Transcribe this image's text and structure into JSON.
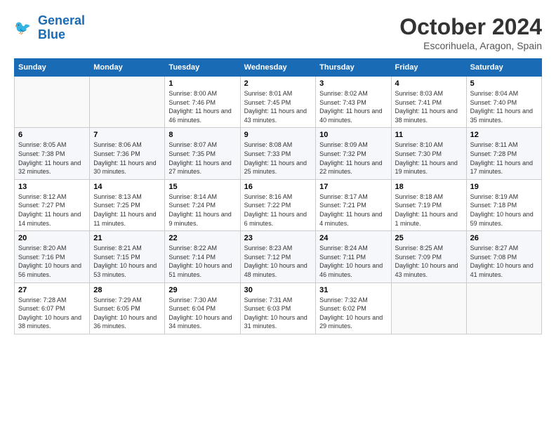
{
  "header": {
    "logo_line1": "General",
    "logo_line2": "Blue",
    "month": "October 2024",
    "location": "Escorihuela, Aragon, Spain"
  },
  "days_of_week": [
    "Sunday",
    "Monday",
    "Tuesday",
    "Wednesday",
    "Thursday",
    "Friday",
    "Saturday"
  ],
  "weeks": [
    [
      {
        "day": "",
        "sunrise": "",
        "sunset": "",
        "daylight": ""
      },
      {
        "day": "",
        "sunrise": "",
        "sunset": "",
        "daylight": ""
      },
      {
        "day": "1",
        "sunrise": "Sunrise: 8:00 AM",
        "sunset": "Sunset: 7:46 PM",
        "daylight": "Daylight: 11 hours and 46 minutes."
      },
      {
        "day": "2",
        "sunrise": "Sunrise: 8:01 AM",
        "sunset": "Sunset: 7:45 PM",
        "daylight": "Daylight: 11 hours and 43 minutes."
      },
      {
        "day": "3",
        "sunrise": "Sunrise: 8:02 AM",
        "sunset": "Sunset: 7:43 PM",
        "daylight": "Daylight: 11 hours and 40 minutes."
      },
      {
        "day": "4",
        "sunrise": "Sunrise: 8:03 AM",
        "sunset": "Sunset: 7:41 PM",
        "daylight": "Daylight: 11 hours and 38 minutes."
      },
      {
        "day": "5",
        "sunrise": "Sunrise: 8:04 AM",
        "sunset": "Sunset: 7:40 PM",
        "daylight": "Daylight: 11 hours and 35 minutes."
      }
    ],
    [
      {
        "day": "6",
        "sunrise": "Sunrise: 8:05 AM",
        "sunset": "Sunset: 7:38 PM",
        "daylight": "Daylight: 11 hours and 32 minutes."
      },
      {
        "day": "7",
        "sunrise": "Sunrise: 8:06 AM",
        "sunset": "Sunset: 7:36 PM",
        "daylight": "Daylight: 11 hours and 30 minutes."
      },
      {
        "day": "8",
        "sunrise": "Sunrise: 8:07 AM",
        "sunset": "Sunset: 7:35 PM",
        "daylight": "Daylight: 11 hours and 27 minutes."
      },
      {
        "day": "9",
        "sunrise": "Sunrise: 8:08 AM",
        "sunset": "Sunset: 7:33 PM",
        "daylight": "Daylight: 11 hours and 25 minutes."
      },
      {
        "day": "10",
        "sunrise": "Sunrise: 8:09 AM",
        "sunset": "Sunset: 7:32 PM",
        "daylight": "Daylight: 11 hours and 22 minutes."
      },
      {
        "day": "11",
        "sunrise": "Sunrise: 8:10 AM",
        "sunset": "Sunset: 7:30 PM",
        "daylight": "Daylight: 11 hours and 19 minutes."
      },
      {
        "day": "12",
        "sunrise": "Sunrise: 8:11 AM",
        "sunset": "Sunset: 7:28 PM",
        "daylight": "Daylight: 11 hours and 17 minutes."
      }
    ],
    [
      {
        "day": "13",
        "sunrise": "Sunrise: 8:12 AM",
        "sunset": "Sunset: 7:27 PM",
        "daylight": "Daylight: 11 hours and 14 minutes."
      },
      {
        "day": "14",
        "sunrise": "Sunrise: 8:13 AM",
        "sunset": "Sunset: 7:25 PM",
        "daylight": "Daylight: 11 hours and 11 minutes."
      },
      {
        "day": "15",
        "sunrise": "Sunrise: 8:14 AM",
        "sunset": "Sunset: 7:24 PM",
        "daylight": "Daylight: 11 hours and 9 minutes."
      },
      {
        "day": "16",
        "sunrise": "Sunrise: 8:16 AM",
        "sunset": "Sunset: 7:22 PM",
        "daylight": "Daylight: 11 hours and 6 minutes."
      },
      {
        "day": "17",
        "sunrise": "Sunrise: 8:17 AM",
        "sunset": "Sunset: 7:21 PM",
        "daylight": "Daylight: 11 hours and 4 minutes."
      },
      {
        "day": "18",
        "sunrise": "Sunrise: 8:18 AM",
        "sunset": "Sunset: 7:19 PM",
        "daylight": "Daylight: 11 hours and 1 minute."
      },
      {
        "day": "19",
        "sunrise": "Sunrise: 8:19 AM",
        "sunset": "Sunset: 7:18 PM",
        "daylight": "Daylight: 10 hours and 59 minutes."
      }
    ],
    [
      {
        "day": "20",
        "sunrise": "Sunrise: 8:20 AM",
        "sunset": "Sunset: 7:16 PM",
        "daylight": "Daylight: 10 hours and 56 minutes."
      },
      {
        "day": "21",
        "sunrise": "Sunrise: 8:21 AM",
        "sunset": "Sunset: 7:15 PM",
        "daylight": "Daylight: 10 hours and 53 minutes."
      },
      {
        "day": "22",
        "sunrise": "Sunrise: 8:22 AM",
        "sunset": "Sunset: 7:14 PM",
        "daylight": "Daylight: 10 hours and 51 minutes."
      },
      {
        "day": "23",
        "sunrise": "Sunrise: 8:23 AM",
        "sunset": "Sunset: 7:12 PM",
        "daylight": "Daylight: 10 hours and 48 minutes."
      },
      {
        "day": "24",
        "sunrise": "Sunrise: 8:24 AM",
        "sunset": "Sunset: 7:11 PM",
        "daylight": "Daylight: 10 hours and 46 minutes."
      },
      {
        "day": "25",
        "sunrise": "Sunrise: 8:25 AM",
        "sunset": "Sunset: 7:09 PM",
        "daylight": "Daylight: 10 hours and 43 minutes."
      },
      {
        "day": "26",
        "sunrise": "Sunrise: 8:27 AM",
        "sunset": "Sunset: 7:08 PM",
        "daylight": "Daylight: 10 hours and 41 minutes."
      }
    ],
    [
      {
        "day": "27",
        "sunrise": "Sunrise: 7:28 AM",
        "sunset": "Sunset: 6:07 PM",
        "daylight": "Daylight: 10 hours and 38 minutes."
      },
      {
        "day": "28",
        "sunrise": "Sunrise: 7:29 AM",
        "sunset": "Sunset: 6:05 PM",
        "daylight": "Daylight: 10 hours and 36 minutes."
      },
      {
        "day": "29",
        "sunrise": "Sunrise: 7:30 AM",
        "sunset": "Sunset: 6:04 PM",
        "daylight": "Daylight: 10 hours and 34 minutes."
      },
      {
        "day": "30",
        "sunrise": "Sunrise: 7:31 AM",
        "sunset": "Sunset: 6:03 PM",
        "daylight": "Daylight: 10 hours and 31 minutes."
      },
      {
        "day": "31",
        "sunrise": "Sunrise: 7:32 AM",
        "sunset": "Sunset: 6:02 PM",
        "daylight": "Daylight: 10 hours and 29 minutes."
      },
      {
        "day": "",
        "sunrise": "",
        "sunset": "",
        "daylight": ""
      },
      {
        "day": "",
        "sunrise": "",
        "sunset": "",
        "daylight": ""
      }
    ]
  ]
}
